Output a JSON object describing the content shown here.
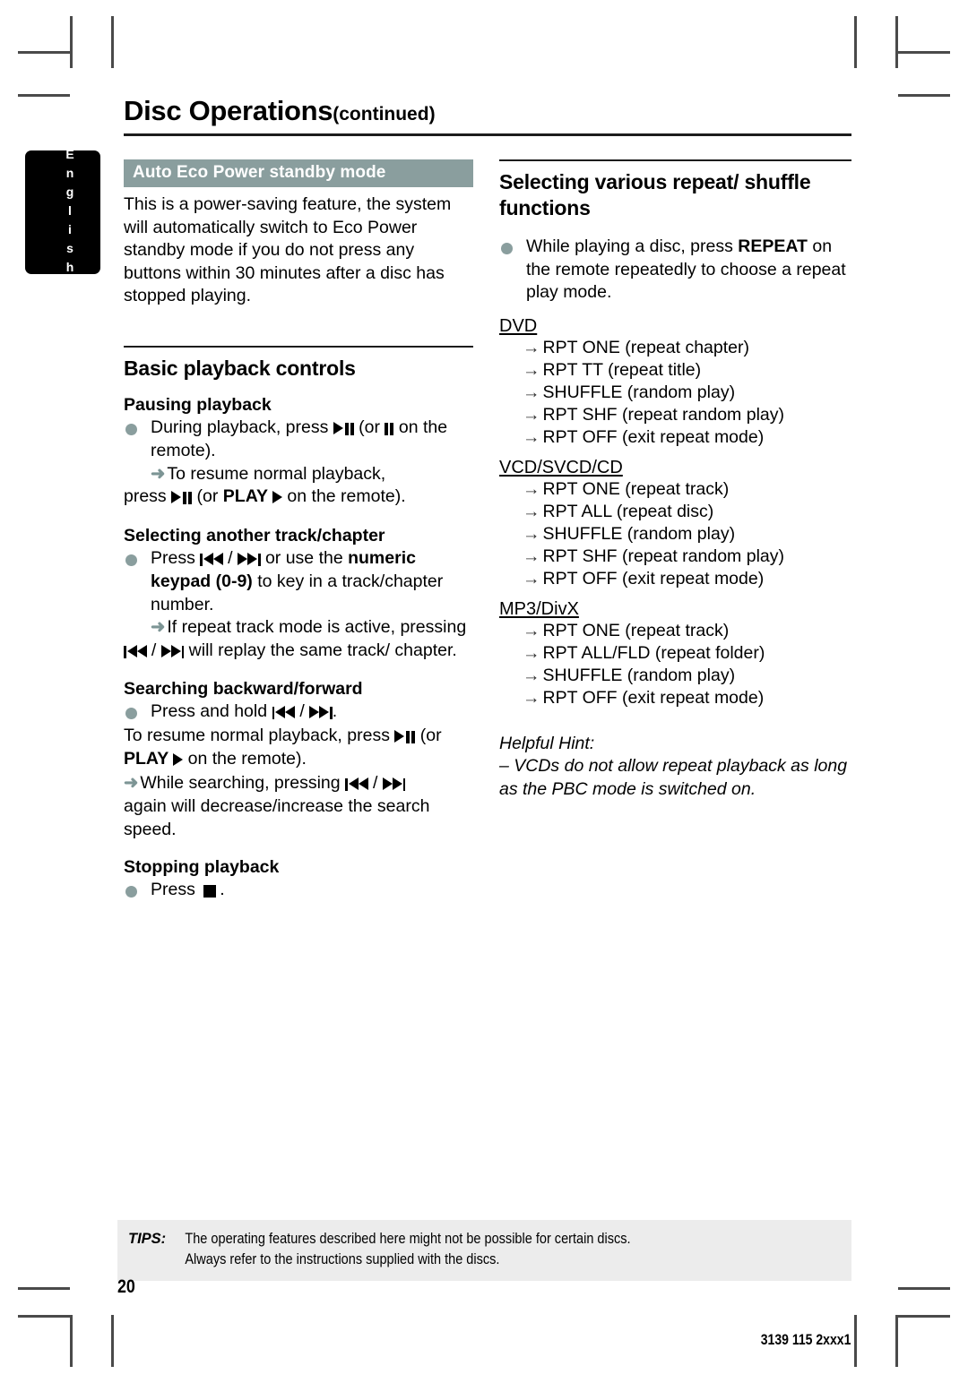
{
  "page": {
    "language_tab": "English",
    "title": "Disc Operations",
    "title_suffix": "(continued)",
    "page_number": "20",
    "document_code": "3139 115 2xxx1",
    "accent_color": "#8a9e9e"
  },
  "left_column": {
    "eco_section": {
      "banner": "Auto Eco Power standby mode",
      "body": "This is a power-saving feature, the system will automatically switch to Eco Power standby mode if you do not press any buttons within 30 minutes after a disc has stopped playing."
    },
    "basic_playback": {
      "heading": "Basic playback controls",
      "pausing": {
        "heading": "Pausing playback",
        "bullet_pre": "During playback, press ",
        "bullet_mid": " (or ",
        "bullet_post": " on the remote).",
        "arrow_line": "To resume normal playback,",
        "arrow_line2_pre": "press ",
        "arrow_line2_mid": " (or ",
        "arrow_line2_bold": "PLAY",
        "arrow_line2_post": " on the remote)."
      },
      "selecting": {
        "heading": "Selecting another track/chapter",
        "bullet_pre": "Press ",
        "bullet_sep": " / ",
        "bullet_post": " or use the ",
        "bullet_bold": "numeric keypad (0-9)",
        "bullet_tail": " to key in a track/chapter number.",
        "arrow_pre": "If repeat track mode is active, pressing ",
        "arrow_post": " will replay the same track/ chapter."
      },
      "searching": {
        "heading": "Searching backward/forward",
        "bullet_pre": "Press and hold ",
        "bullet_sep": " / ",
        "bullet_post": ".",
        "line2_pre": "To resume normal playback, press ",
        "line2_mid": " (or ",
        "line2_bold": "PLAY",
        "line2_post": " on the remote).",
        "arrow_pre": "While searching, pressing ",
        "arrow_post": "again will decrease/increase the search speed."
      },
      "stopping": {
        "heading": "Stopping playback",
        "bullet_pre": "Press ",
        "bullet_post": "."
      }
    }
  },
  "right_column": {
    "repeat_section": {
      "heading": "Selecting various repeat/ shuffle functions",
      "intro_pre": "While playing a disc, press ",
      "intro_bold": "REPEAT",
      "intro_post": " on the remote repeatedly to choose a repeat play mode.",
      "groups": [
        {
          "label": "DVD",
          "modes": [
            "RPT ONE (repeat chapter)",
            "RPT  TT (repeat title)",
            "SHUFFLE (random play)",
            "RPT SHF (repeat random play)",
            "RPT OFF (exit repeat mode)"
          ]
        },
        {
          "label": "VCD/SVCD/CD",
          "modes": [
            "RPT ONE (repeat track)",
            "RPT ALL (repeat disc)",
            "SHUFFLE (random play)",
            "RPT SHF (repeat random play)",
            "RPT OFF (exit repeat mode)"
          ]
        },
        {
          "label": "MP3/DivX",
          "modes": [
            "RPT ONE (repeat track)",
            "RPT ALL/FLD (repeat folder)",
            "SHUFFLE (random play)",
            "RPT OFF (exit repeat mode)"
          ]
        }
      ],
      "hint_title": "Helpful Hint:",
      "hint_body": "– VCDs do not allow repeat playback as long as the PBC mode is switched on."
    }
  },
  "footer": {
    "tips_label": "TIPS:",
    "tips_line1": "The operating features described here might not be possible for certain discs.",
    "tips_line2": "Always refer to the instructions supplied with the discs."
  }
}
